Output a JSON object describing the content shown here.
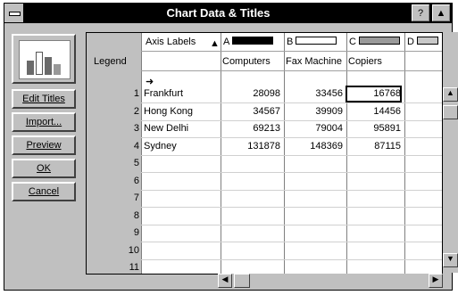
{
  "window": {
    "title": "Chart Data & Titles",
    "help_label": "?"
  },
  "buttons": {
    "edit_titles": "Edit Titles",
    "import": "Import...",
    "preview": "Preview",
    "ok": "OK",
    "cancel": "Cancel"
  },
  "grid": {
    "axis_labels_header": "Axis Labels",
    "legend_label": "Legend",
    "series": [
      {
        "letter": "A",
        "swatch": "#000000",
        "name": "Computers"
      },
      {
        "letter": "B",
        "swatch": "#ffffff",
        "name": "Fax Machine"
      },
      {
        "letter": "C",
        "swatch": "#9a9a9a",
        "name": "Copiers"
      },
      {
        "letter": "D",
        "swatch": "#c8c8c8",
        "name": ""
      }
    ],
    "rows": [
      {
        "n": "1",
        "label": "Frankfurt",
        "a": "28098",
        "b": "33456",
        "c": "16768"
      },
      {
        "n": "2",
        "label": "Hong Kong",
        "a": "34567",
        "b": "39909",
        "c": "14456"
      },
      {
        "n": "3",
        "label": "New Delhi",
        "a": "69213",
        "b": "79004",
        "c": "95891"
      },
      {
        "n": "4",
        "label": "Sydney",
        "a": "131878",
        "b": "148369",
        "c": "87115"
      },
      {
        "n": "5",
        "label": "",
        "a": "",
        "b": "",
        "c": ""
      },
      {
        "n": "6",
        "label": "",
        "a": "",
        "b": "",
        "c": ""
      },
      {
        "n": "7",
        "label": "",
        "a": "",
        "b": "",
        "c": ""
      },
      {
        "n": "8",
        "label": "",
        "a": "",
        "b": "",
        "c": ""
      },
      {
        "n": "9",
        "label": "",
        "a": "",
        "b": "",
        "c": ""
      },
      {
        "n": "10",
        "label": "",
        "a": "",
        "b": "",
        "c": ""
      },
      {
        "n": "11",
        "label": "",
        "a": "",
        "b": "",
        "c": ""
      }
    ]
  },
  "icons": {
    "system_menu": "system-menu-icon",
    "chart_preview": "bar-chart-icon",
    "scroll_up": "arrow-up-icon",
    "scroll_down": "arrow-down-icon",
    "scroll_left": "arrow-left-icon",
    "scroll_right": "arrow-right-icon"
  }
}
